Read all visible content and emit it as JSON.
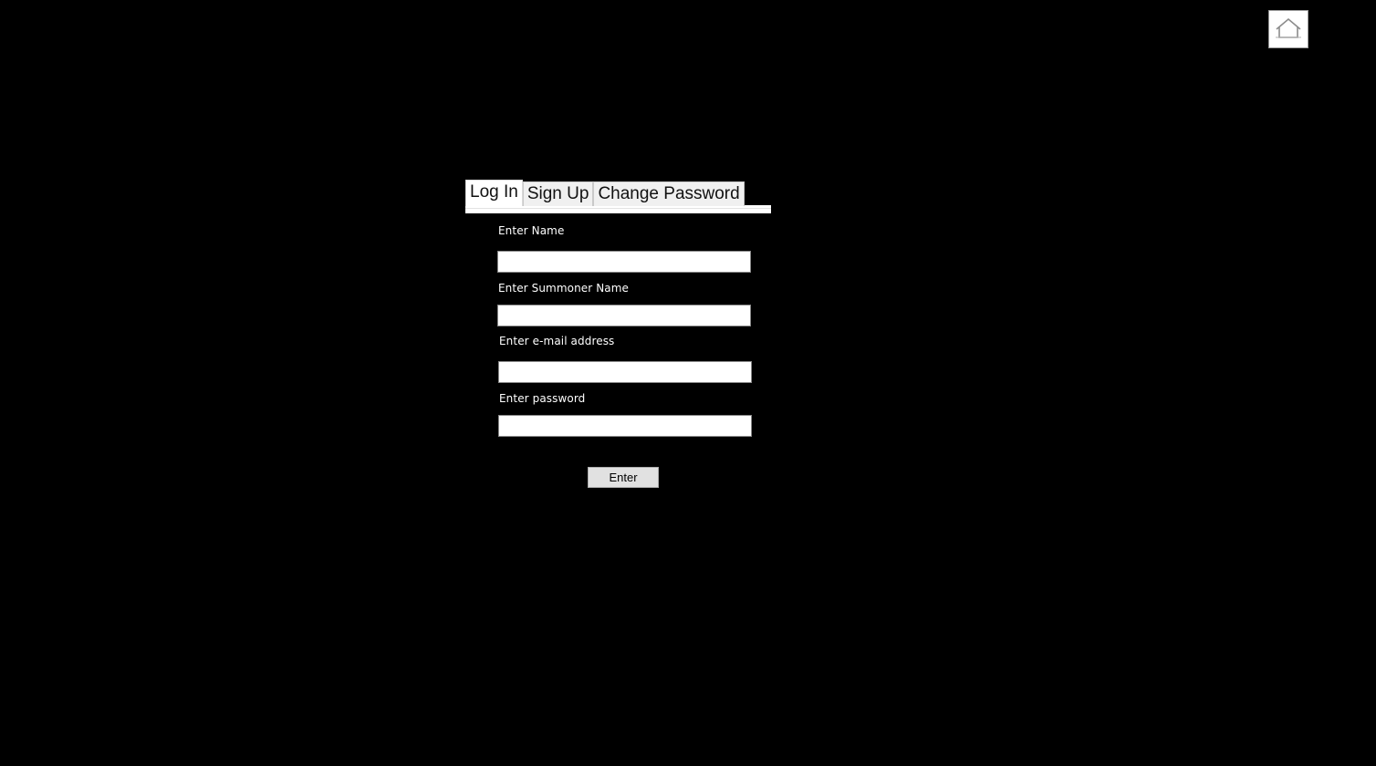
{
  "header": {
    "home_icon": "home-icon"
  },
  "tabs": [
    {
      "label": "Log In",
      "active": true
    },
    {
      "label": "Sign Up",
      "active": false
    },
    {
      "label": "Change Password",
      "active": false
    }
  ],
  "form": {
    "name": {
      "label": "Enter Name",
      "value": "",
      "placeholder": ""
    },
    "summoner": {
      "label": "Enter Summoner Name",
      "value": "",
      "placeholder": ""
    },
    "email": {
      "label": "Enter e-mail address",
      "value": "",
      "placeholder": ""
    },
    "password": {
      "label": "Enter password",
      "value": "",
      "placeholder": ""
    },
    "submit_label": "Enter"
  },
  "colors": {
    "background": "#000000",
    "label_text": "#ffffff",
    "button_bg": "#e1e1e1"
  }
}
